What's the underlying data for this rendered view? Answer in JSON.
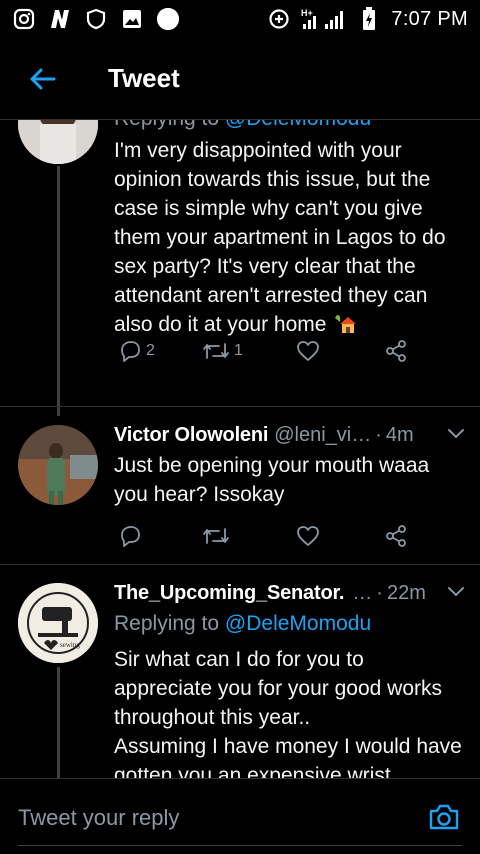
{
  "status_bar": {
    "time": "7:07 PM",
    "icons": [
      "instagram-icon",
      "nfl-icon",
      "shield-icon",
      "gallery-icon",
      "circle-icon",
      "data-saver-icon",
      "signal-icon",
      "battery-icon"
    ],
    "network": "H+"
  },
  "header": {
    "title": "Tweet",
    "back_icon": "arrow-left-icon"
  },
  "tweets": [
    {
      "reply_prefix": "Replying to ",
      "reply_mention": "@DeleMomodu",
      "text": "I'm very disappointed with your opinion towards this issue, but the case is simple why can't you give them your apartment in Lagos to do sex party? It's very clear that the attendant aren't arrested they can also do it at your home",
      "emoji": "house-with-garden-emoji",
      "replies": "2",
      "retweets": "1",
      "likes": ""
    },
    {
      "name": "Victor Olowoleni",
      "handle": "@leni_vi…",
      "time": "4m",
      "text": "Just be opening your mouth waaa you hear? Issokay",
      "replies": "",
      "retweets": "",
      "likes": ""
    },
    {
      "name": "The_Upcoming_Senator.",
      "handle": "…",
      "time": "22m",
      "reply_prefix": "Replying to ",
      "reply_mention": "@DeleMomodu",
      "text_lines": [
        "Sir what can I do for you to appreciate you for your good works throughout this year..",
        "Assuming I have money I would have gotten you an expensive wrist"
      ]
    }
  ],
  "reply_bar": {
    "placeholder": "Tweet your reply",
    "camera_icon": "camera-icon"
  },
  "colors": {
    "background": "#000000",
    "accent": "#1da1f2",
    "secondary_text": "#8899a6",
    "divider": "#2f3336"
  }
}
